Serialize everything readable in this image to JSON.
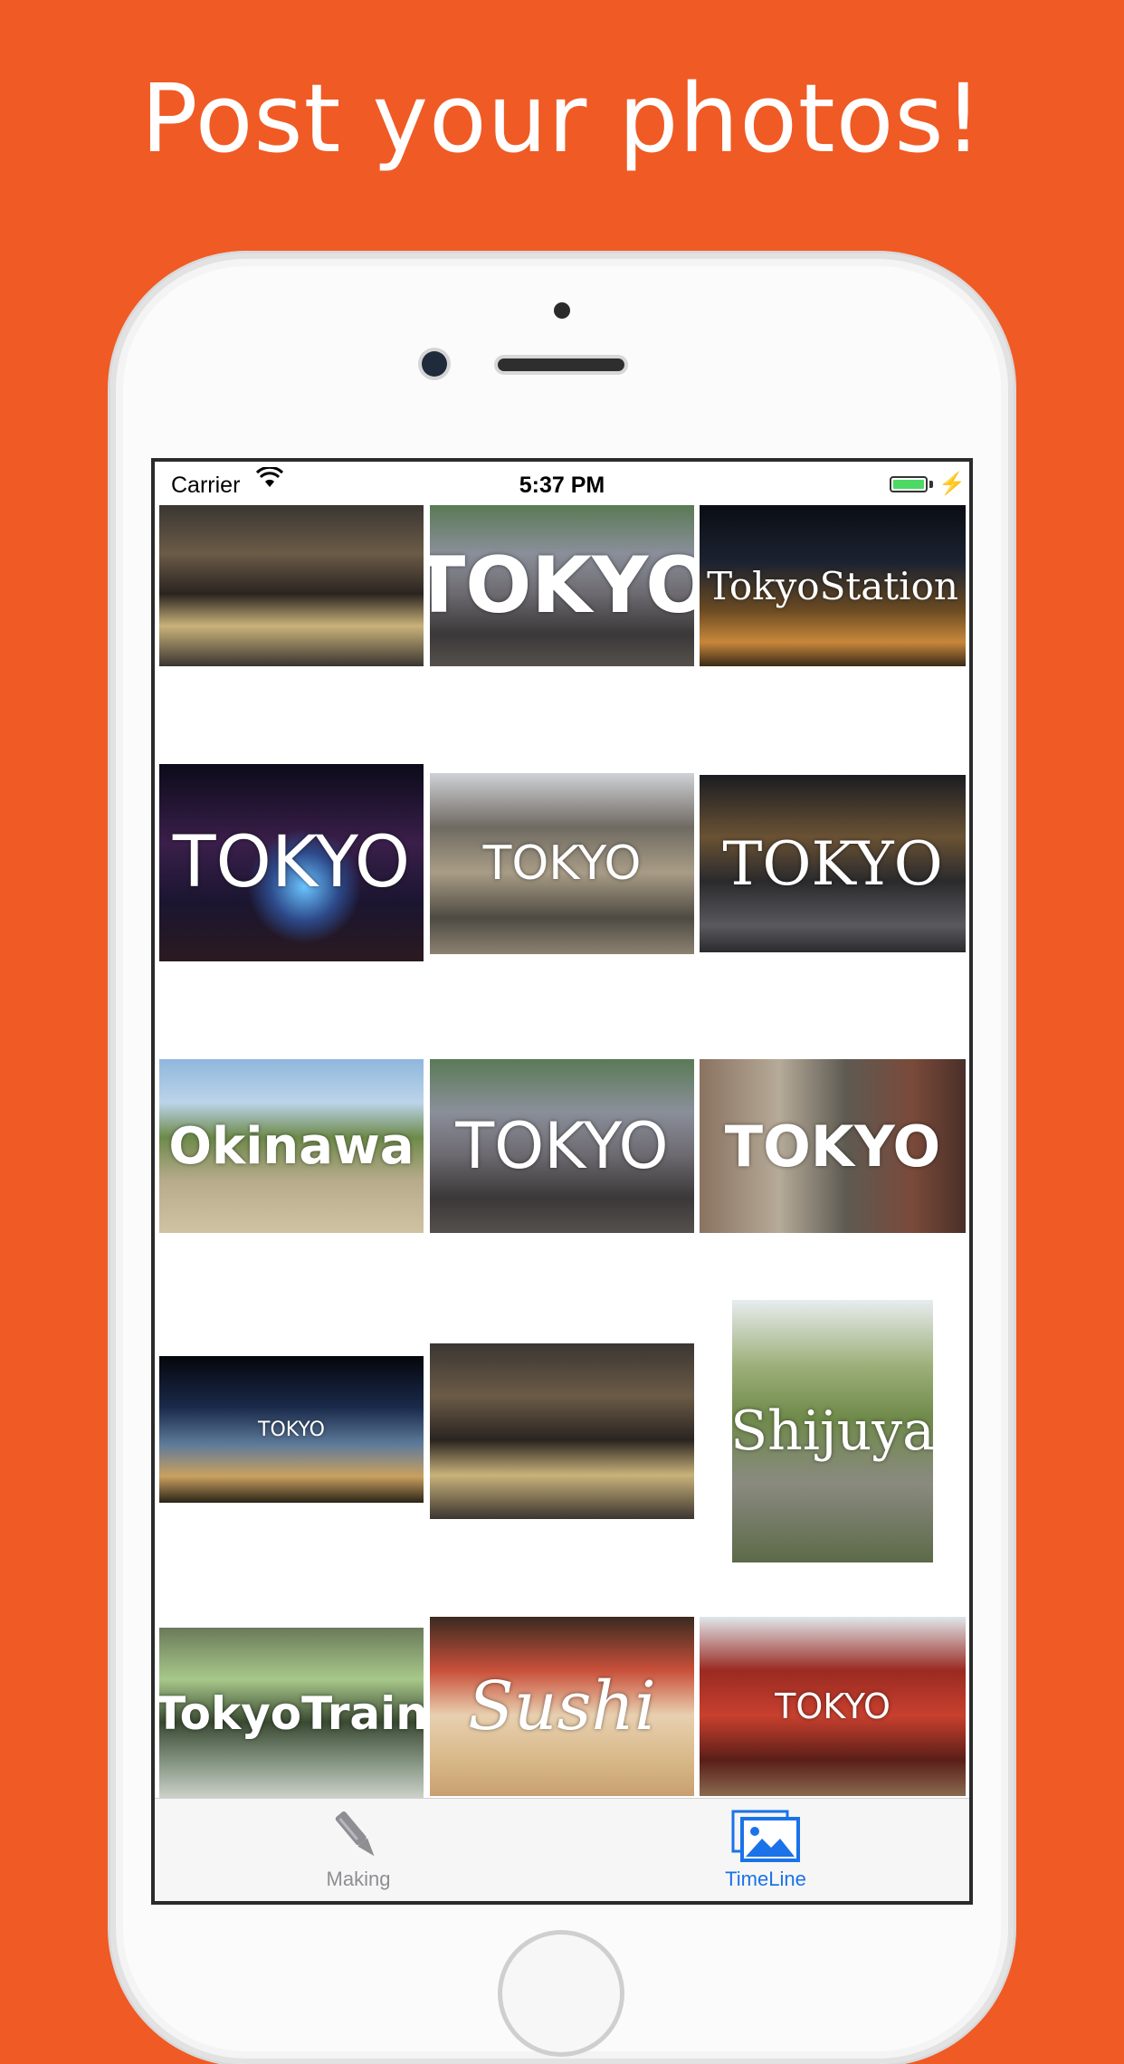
{
  "headline": "Post your photos!",
  "status_bar": {
    "carrier": "Carrier",
    "time": "5:37 PM"
  },
  "colors": {
    "background": "#f05a24",
    "tab_active": "#1a73e8",
    "tab_inactive": "#8e8e93",
    "battery": "#4cd964"
  },
  "photos": [
    {
      "caption": "",
      "scene": "station-night"
    },
    {
      "caption": "TOKYO",
      "scene": "crowd"
    },
    {
      "caption": "TokyoStation",
      "scene": "night-building"
    },
    {
      "caption": "TOKYO",
      "scene": "ferris-night"
    },
    {
      "caption": "TOKYO",
      "scene": "fish-market"
    },
    {
      "caption": "TOKYO",
      "scene": "street-night"
    },
    {
      "caption": "Okinawa",
      "scene": "beach-path"
    },
    {
      "caption": "TOKYO",
      "scene": "crowd"
    },
    {
      "caption": "TOKYO",
      "scene": "alley"
    },
    {
      "caption": "TOKYO",
      "scene": "dome-night"
    },
    {
      "caption": "",
      "scene": "station-night"
    },
    {
      "caption": "Shijuya",
      "scene": "rail-bridge"
    },
    {
      "caption": "TokyoTrain",
      "scene": "train"
    },
    {
      "caption": "Sushi",
      "scene": "sushi"
    },
    {
      "caption": "TOKYO",
      "scene": "temple-gate"
    }
  ],
  "tabs": [
    {
      "label": "Making",
      "icon": "pen-icon",
      "active": false
    },
    {
      "label": "TimeLine",
      "icon": "photo-gallery-icon",
      "active": true
    }
  ]
}
